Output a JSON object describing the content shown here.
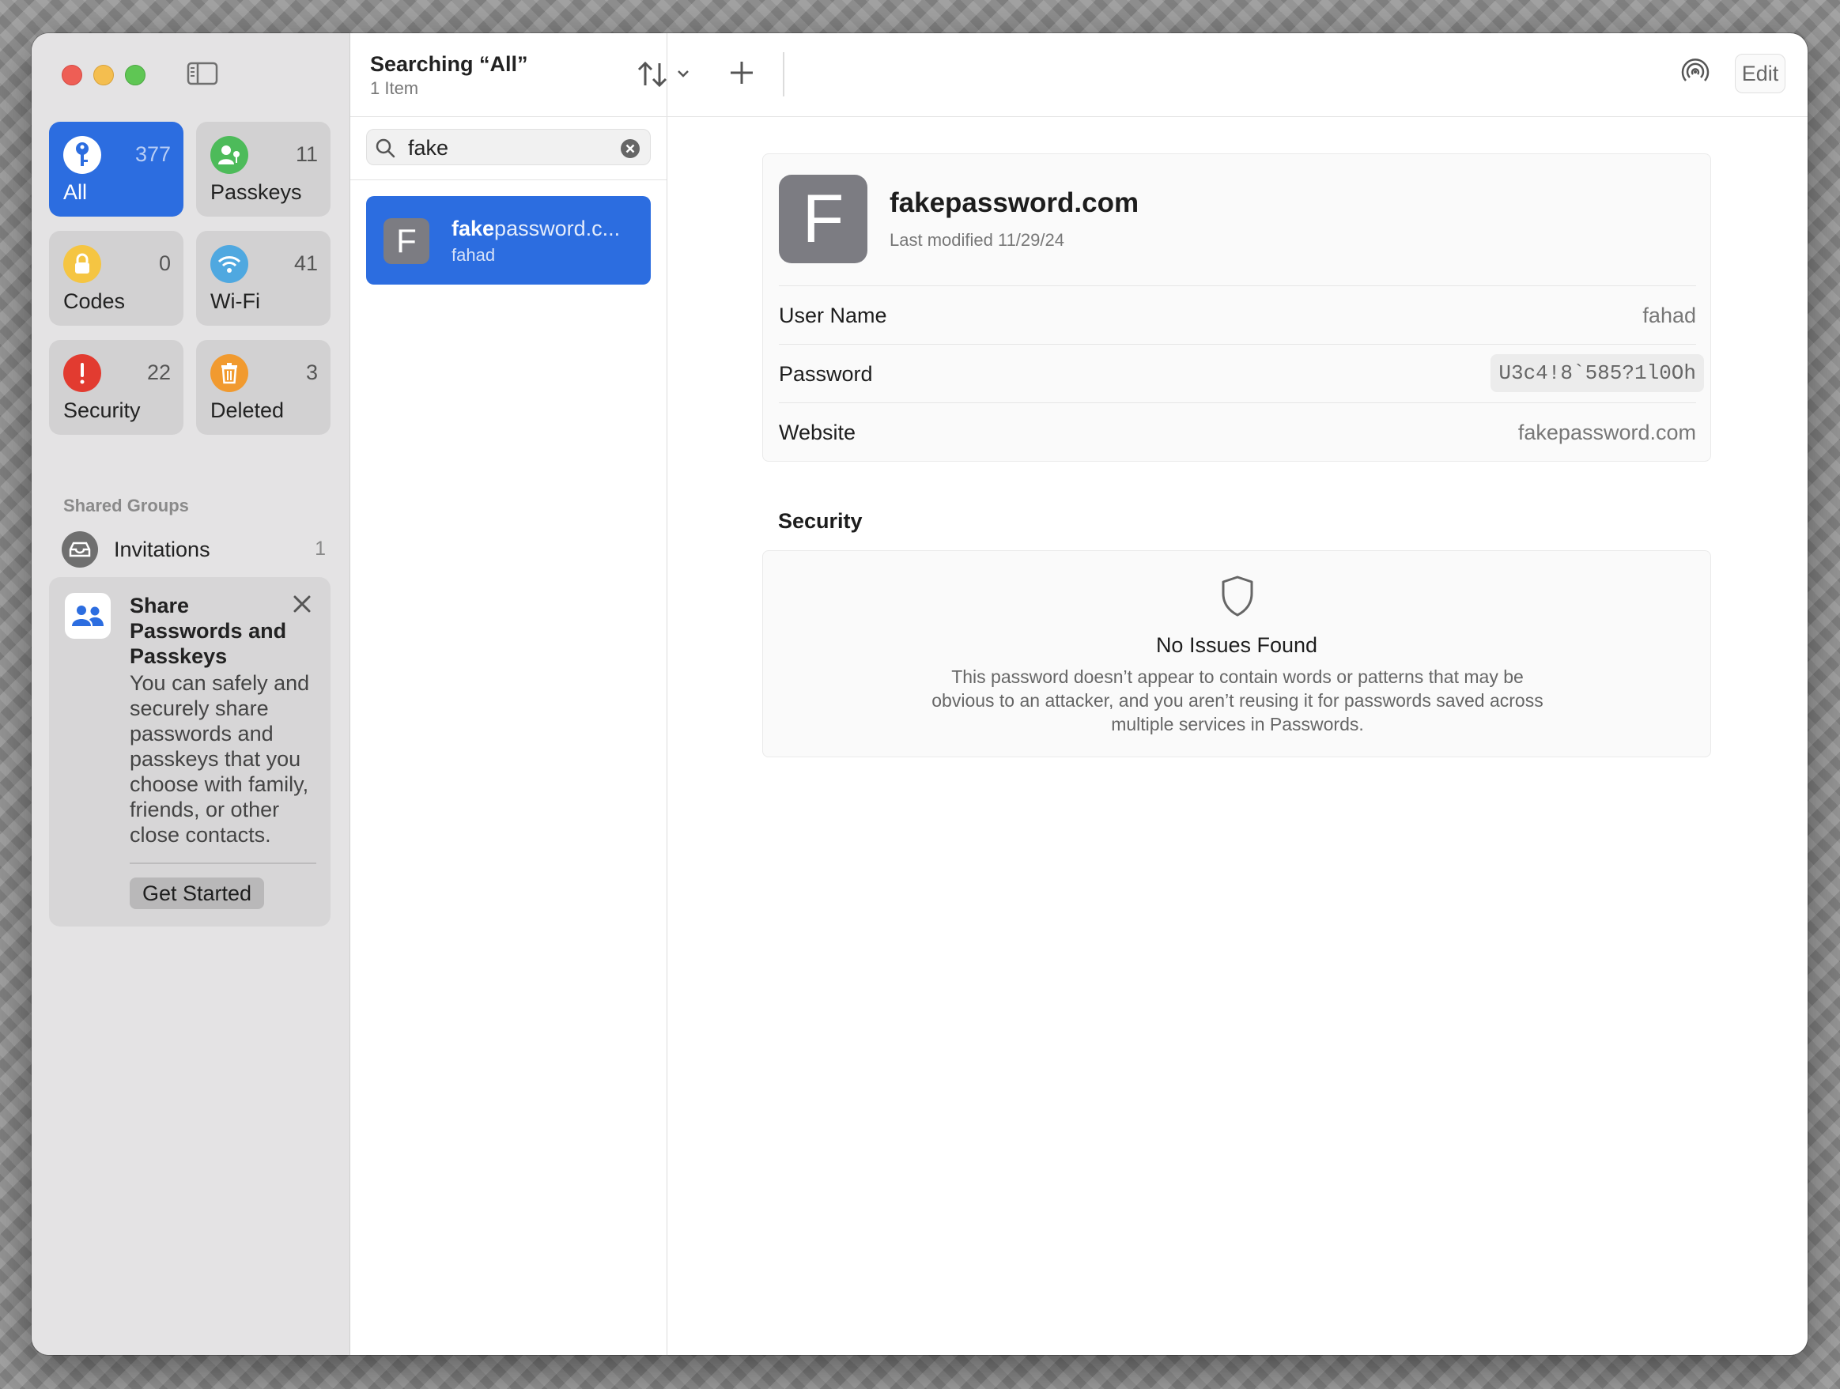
{
  "sidebar": {
    "tiles": [
      {
        "label": "All",
        "count": "377",
        "icon": "key-icon",
        "color": "#2c6de0"
      },
      {
        "label": "Passkeys",
        "count": "11",
        "icon": "passkey-icon",
        "color": "#4dbb5a"
      },
      {
        "label": "Codes",
        "count": "0",
        "icon": "lock-icon",
        "color": "#f5c542"
      },
      {
        "label": "Wi-Fi",
        "count": "41",
        "icon": "wifi-icon",
        "color": "#4fa8e0"
      },
      {
        "label": "Security",
        "count": "22",
        "icon": "exclamation-icon",
        "color": "#e23b30"
      },
      {
        "label": "Deleted",
        "count": "3",
        "icon": "trash-icon",
        "color": "#f19a2f"
      }
    ],
    "shared_groups_header": "Shared Groups",
    "invitations": {
      "label": "Invitations",
      "count": "1"
    },
    "share_card": {
      "title": "Share Passwords and Passkeys",
      "body": "You can safely and securely share passwords and passkeys that you choose with family, friends, or other close contacts.",
      "button": "Get Started"
    }
  },
  "toolbar": {
    "title": "Searching “All”",
    "subtitle": "1 Item",
    "edit_label": "Edit"
  },
  "search": {
    "value": "fake"
  },
  "results": [
    {
      "avatar": "F",
      "title_match": "fake",
      "title_rest": "password.c...",
      "subtitle": "fahad"
    }
  ],
  "detail": {
    "avatar": "F",
    "title": "fakepassword.com",
    "modified": "Last modified 11/29/24",
    "fields": {
      "username_label": "User Name",
      "username_value": "fahad",
      "password_label": "Password",
      "password_value": "U3c4!8`585?1l0Oh",
      "website_label": "Website",
      "website_value": "fakepassword.com"
    },
    "security": {
      "section_title": "Security",
      "heading": "No Issues Found",
      "description": "This password doesn’t appear to contain words or patterns that may be obvious to an attacker, and you aren’t reusing it for passwords saved across multiple services in Passwords."
    }
  },
  "colors": {
    "accent": "#2c6de0",
    "sidebar_bg": "#e4e3e4"
  }
}
